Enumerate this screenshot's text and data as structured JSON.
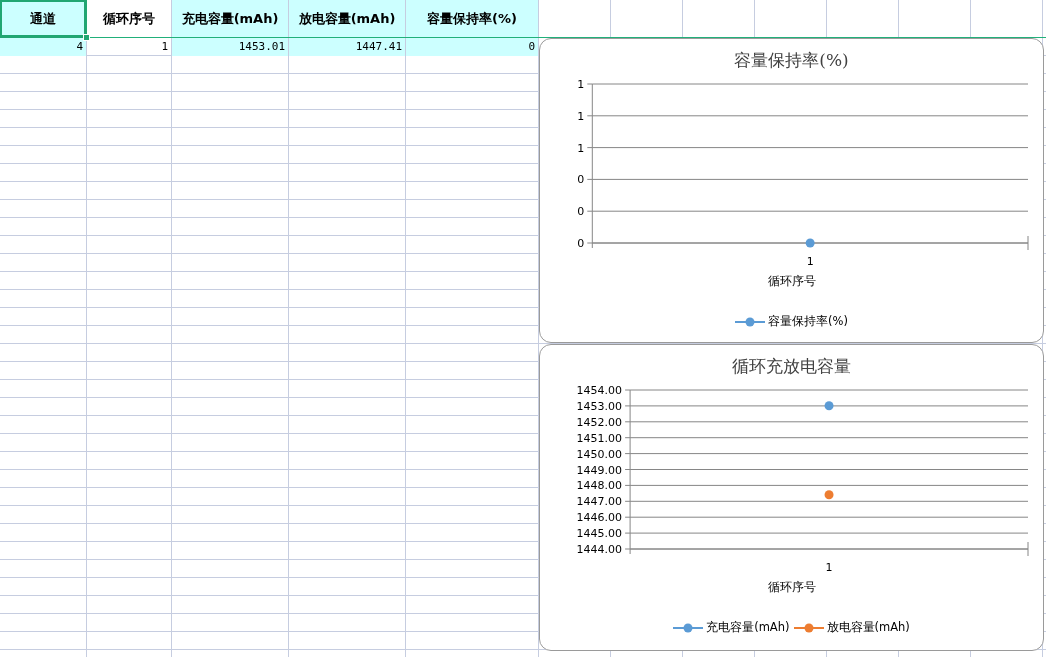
{
  "sheet": {
    "columns": [
      {
        "header": "通道",
        "highlighted": true,
        "selected": true
      },
      {
        "header": "循环序号",
        "highlighted": false,
        "selected": false
      },
      {
        "header": "充电容量(mAh)",
        "highlighted": true,
        "selected": false
      },
      {
        "header": "放电容量(mAh)",
        "highlighted": true,
        "selected": false
      },
      {
        "header": "容量保持率(%)",
        "highlighted": true,
        "selected": false
      }
    ],
    "rows": [
      {
        "cells": [
          "4",
          "1",
          "1453.01",
          "1447.41",
          "0"
        ]
      }
    ]
  },
  "charts": [
    {
      "chart_data": {
        "type": "line",
        "title": "容量保持率(%)",
        "xlabel": "循环序号",
        "categories": [
          "1"
        ],
        "grid": true,
        "legend": true,
        "series": [
          {
            "name": "容量保持率(%)",
            "color": "#5b9bd5",
            "marker": "circle",
            "values": [
              0
            ]
          }
        ],
        "ylim": [
          0,
          1
        ],
        "yticks": [
          {
            "value": 0,
            "label": "0"
          },
          {
            "value": 0.2,
            "label": "0"
          },
          {
            "value": 0.4,
            "label": "0"
          },
          {
            "value": 0.6,
            "label": "1"
          },
          {
            "value": 0.8,
            "label": "1"
          },
          {
            "value": 1,
            "label": "1"
          }
        ]
      }
    },
    {
      "chart_data": {
        "type": "line",
        "title": "循环充放电容量",
        "xlabel": "循环序号",
        "categories": [
          "1"
        ],
        "grid": true,
        "legend": true,
        "series": [
          {
            "name": "充电容量(mAh)",
            "color": "#5b9bd5",
            "marker": "circle",
            "values": [
              1453.01
            ]
          },
          {
            "name": "放电容量(mAh)",
            "color": "#ed7d31",
            "marker": "circle",
            "values": [
              1447.41
            ]
          }
        ],
        "ylim": [
          1444,
          1454
        ],
        "yticks": [
          {
            "value": 1444,
            "label": "1444.00"
          },
          {
            "value": 1445,
            "label": "1445.00"
          },
          {
            "value": 1446,
            "label": "1446.00"
          },
          {
            "value": 1447,
            "label": "1447.00"
          },
          {
            "value": 1448,
            "label": "1448.00"
          },
          {
            "value": 1449,
            "label": "1449.00"
          },
          {
            "value": 1450,
            "label": "1450.00"
          },
          {
            "value": 1451,
            "label": "1451.00"
          },
          {
            "value": 1452,
            "label": "1452.00"
          },
          {
            "value": 1453,
            "label": "1453.00"
          },
          {
            "value": 1454,
            "label": "1454.00"
          }
        ]
      }
    }
  ]
}
